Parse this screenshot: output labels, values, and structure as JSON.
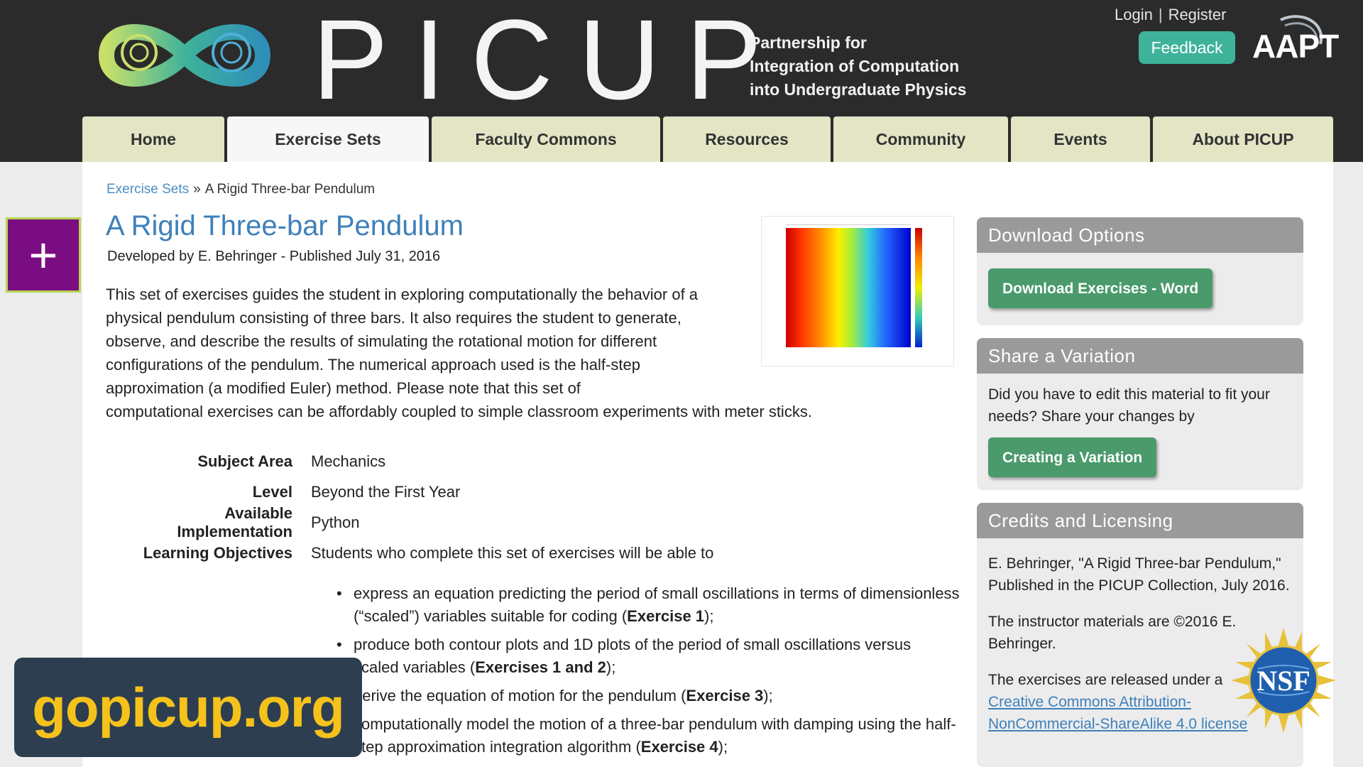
{
  "header": {
    "brand": "PICUP",
    "tagline": [
      "Partnership for",
      "Integration of Computation",
      "into Undergraduate Physics"
    ],
    "login": "Login",
    "separator": "|",
    "register": "Register",
    "feedback": "Feedback",
    "partner_logo": "AAPT"
  },
  "nav": {
    "tabs": [
      {
        "label": "Home"
      },
      {
        "label": "Exercise Sets"
      },
      {
        "label": "Faculty Commons"
      },
      {
        "label": "Resources"
      },
      {
        "label": "Community"
      },
      {
        "label": "Events"
      },
      {
        "label": "About PICUP"
      }
    ],
    "active_index": 1
  },
  "breadcrumb": {
    "parent": "Exercise Sets",
    "separator": "»",
    "current": "A Rigid Three-bar Pendulum"
  },
  "plus_button": "+",
  "article": {
    "title": "A Rigid Three-bar Pendulum",
    "byline": "Developed by E. Behringer - Published July 31, 2016",
    "description_wrapped": "This set of exercises guides the student in exploring computationally the behavior of a physical pendulum consisting of three bars. It also requires the student to generate, observe, and describe the results of simulating the rotational motion for different configurations of the pendulum. The numerical approach used is the half-step approximation (a modified Euler) method. Please note that this set of",
    "description_last": "computational exercises can be affordably coupled to simple classroom experiments with meter sticks.",
    "meta": [
      {
        "label": "Subject Area",
        "value": "Mechanics"
      },
      {
        "label": "Level",
        "value": "Beyond the First Year"
      },
      {
        "label": "Available Implementation",
        "value": "Python"
      },
      {
        "label": "Learning Objectives",
        "value": "Students who complete this set of exercises will be able to"
      }
    ],
    "objectives": [
      {
        "text": "express an equation predicting the period of small oscillations in terms of dimensionless (“scaled”) variables suitable for coding (",
        "bold": "Exercise 1",
        "tail": ");"
      },
      {
        "text": "produce both contour plots and 1D plots of the period of small oscillations versus scaled variables (",
        "bold": "Exercises 1 and 2",
        "tail": ");"
      },
      {
        "text": "derive the equation of motion for the pendulum (",
        "bold": "Exercise 3",
        "tail": ");"
      },
      {
        "text": "computationally model the motion of a three-bar pendulum with damping using the half-step approximation integration algorithm (",
        "bold": "Exercise 4",
        "tail": ");"
      }
    ]
  },
  "site_badge": "gopicup.org",
  "sidebar": {
    "download": {
      "title": "Download Options",
      "button": "Download Exercises - Word"
    },
    "share": {
      "title": "Share a Variation",
      "text": "Did you have to edit this material to fit your needs? Share your changes by",
      "button": "Creating a Variation"
    },
    "credits": {
      "title": "Credits and Licensing",
      "citation": "E. Behringer, \"A Rigid Three-bar Pendulum,\" Published in the PICUP Collection, July 2016.",
      "copyright": "The instructor materials are ©2016 E. Behringer.",
      "license_intro": "The exercises are released under a",
      "license_link": "Creative Commons Attribution-NonCommercial-ShareAlike 4.0 license"
    },
    "nsf_logo": "NSF"
  },
  "colors": {
    "header_bg": "#2b2b2b",
    "nav_tab": "#e3e5c5",
    "link": "#3e80bb",
    "feedback": "#3fb39a",
    "green_button": "#4a9a6b",
    "plus_bg": "#7b0d82",
    "badge_bg": "#2c3e50",
    "badge_text": "#f5c21b"
  },
  "icons": {
    "logo": "picup-swirl-logo",
    "plus": "plus-icon",
    "nsf": "nsf-globe-logo",
    "aapt": "aapt-logo"
  }
}
